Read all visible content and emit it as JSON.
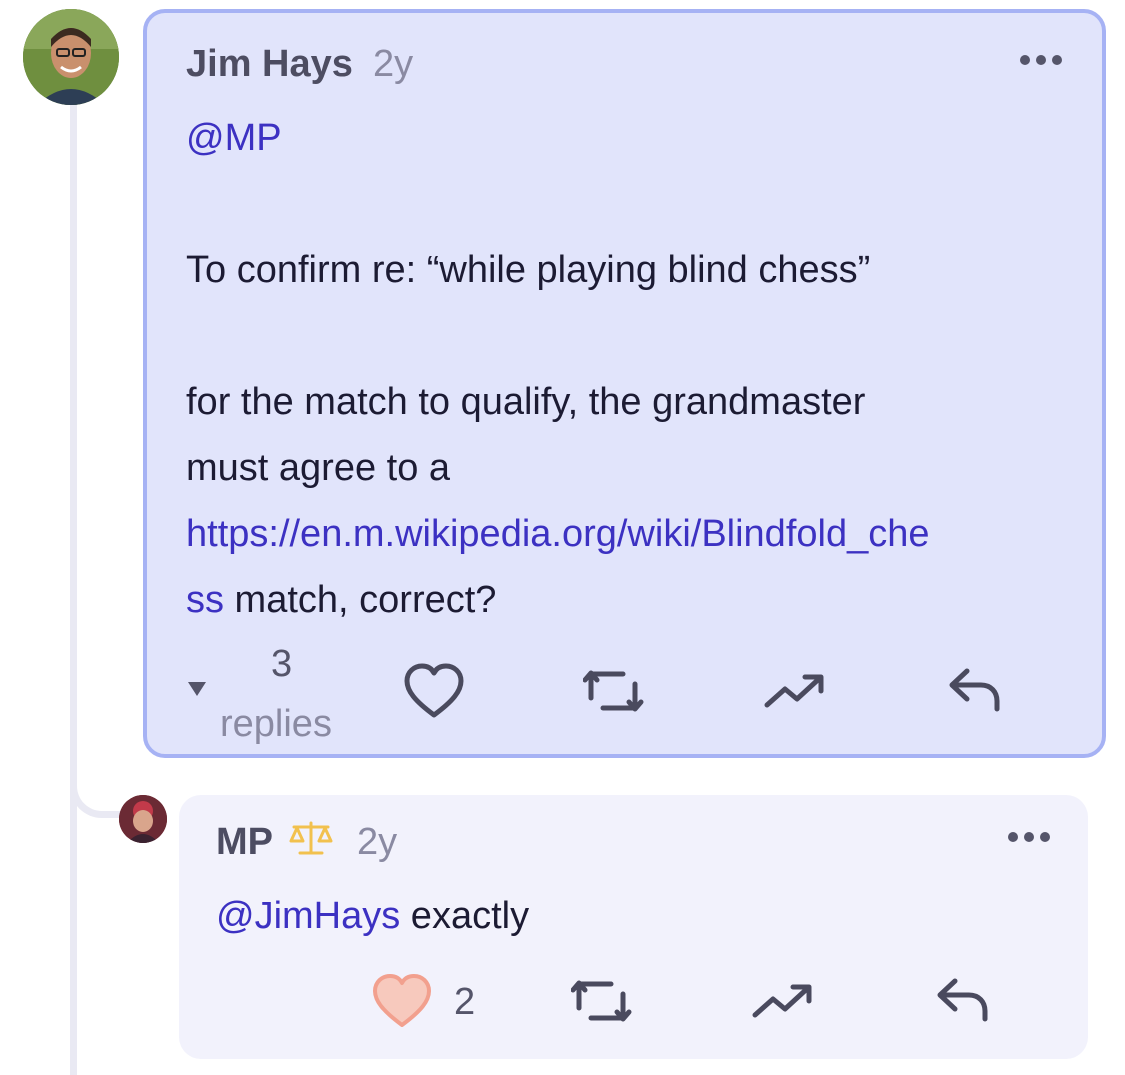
{
  "post": {
    "author": "Jim Hays",
    "time": "2y",
    "mention": "@MP",
    "line1": "To confirm re: “while playing blind chess”",
    "line2": "for the match to qualify, the grandmaster",
    "line3": "must agree to a",
    "link_part1": "https://en.m.wikipedia.org/wiki/Blindfold_che",
    "link_part2": "ss",
    "line4_tail": " match, correct?",
    "replies_count": "3",
    "replies_label": "replies"
  },
  "reply": {
    "author": "MP",
    "time": "2y",
    "mention": "@JimHays",
    "text": " exactly",
    "like_count": "2"
  },
  "icons": {
    "more": "more-horizontal-icon",
    "like": "heart-icon",
    "repost": "repost-icon",
    "trend": "trending-up-icon",
    "reply": "reply-arrow-icon",
    "collapse": "triangle-down-icon",
    "badge": "balance-scale-icon"
  },
  "colors": {
    "accent": "#3c31c2",
    "card_main_bg": "#e1e4fb",
    "card_main_border": "#a6b2f4",
    "card_reply_bg": "#f2f2fc",
    "liked_heart": "#f7c9bd",
    "badge": "#f2c14e"
  }
}
